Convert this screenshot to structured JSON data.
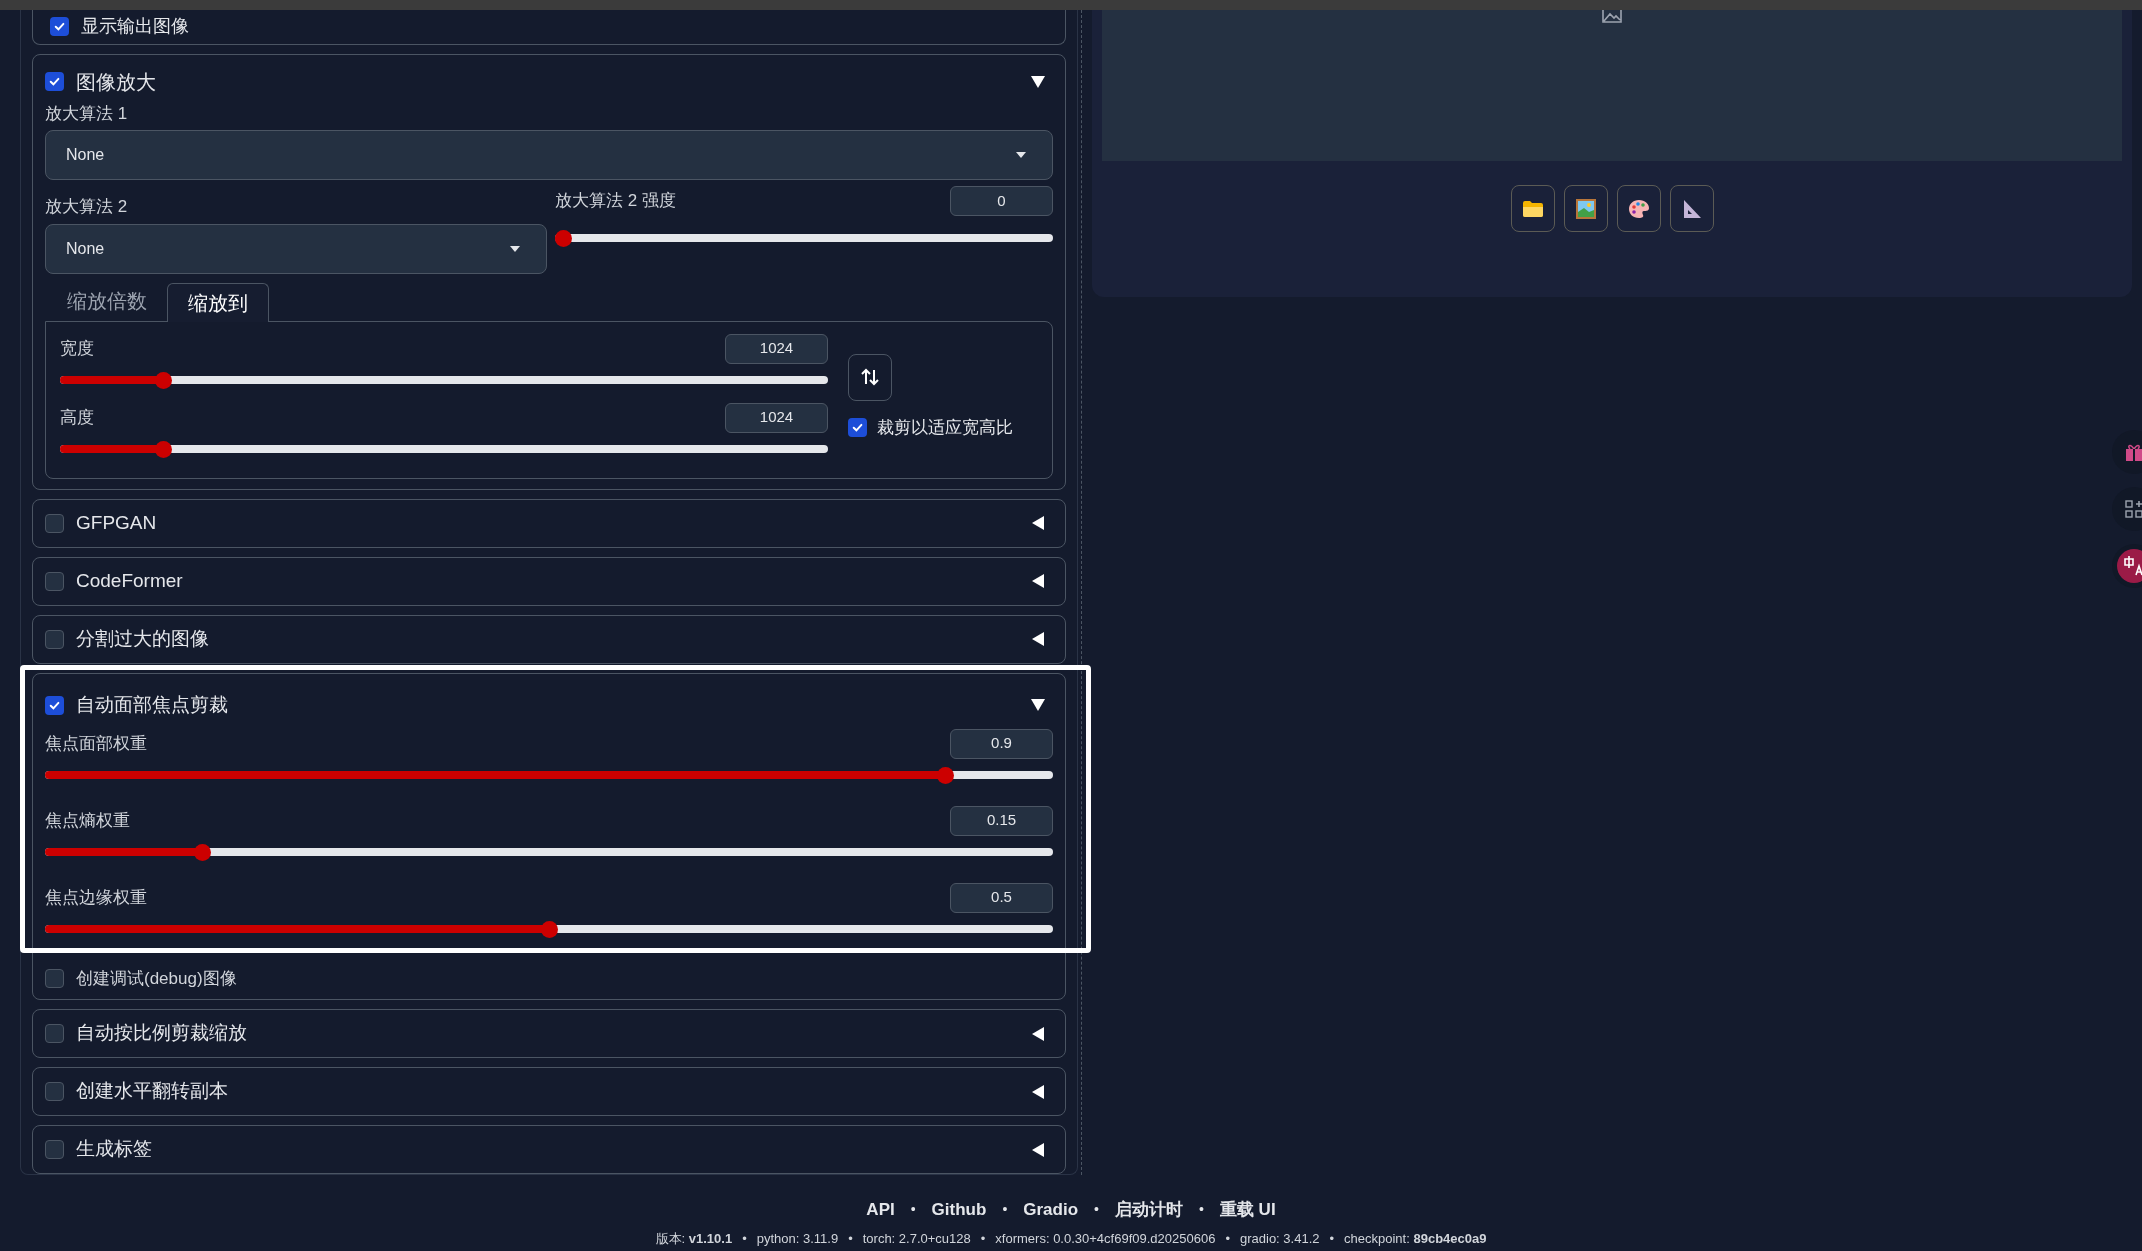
{
  "left_panel": {
    "show_output": {
      "label": "显示输出图像",
      "checked": true
    },
    "upscale": {
      "title": "图像放大",
      "checked": true,
      "expanded": true,
      "upscaler1": {
        "label": "放大算法 1",
        "value": "None"
      },
      "upscaler2": {
        "label": "放大算法 2",
        "value": "None"
      },
      "upscaler2_strength": {
        "label": "放大算法 2 强度",
        "value": "0",
        "level": 0
      },
      "tabs": [
        {
          "label": "缩放倍数",
          "selected": false
        },
        {
          "label": "缩放到",
          "selected": true
        }
      ],
      "size_sliders": [
        {
          "label": "宽度",
          "value": "1024",
          "level": 0.127
        },
        {
          "label": "高度",
          "value": "1024",
          "level": 0.127
        }
      ],
      "crop_to_fit": {
        "label": "裁剪以适应宽高比",
        "checked": true
      }
    },
    "accordions": [
      {
        "title": "GFPGAN",
        "checked": false,
        "expanded": false
      },
      {
        "title": "CodeFormer",
        "checked": false,
        "expanded": false
      },
      {
        "title": "分割过大的图像",
        "checked": false,
        "expanded": false
      },
      {
        "title": "自动面部焦点剪裁",
        "checked": true,
        "expanded": true,
        "highlighted": true,
        "sliders": [
          {
            "label": "焦点面部权重",
            "value": "0.9",
            "level": 0.9
          },
          {
            "label": "焦点熵权重",
            "value": "0.15",
            "level": 0.15
          },
          {
            "label": "焦点边缘权重",
            "value": "0.5",
            "level": 0.5
          }
        ],
        "options": [
          {
            "label": "创建调试(debug)图像",
            "checked": false
          }
        ]
      },
      {
        "title": "自动按比例剪裁缩放",
        "checked": false,
        "expanded": false
      },
      {
        "title": "创建水平翻转副本",
        "checked": false,
        "expanded": false
      },
      {
        "title": "生成标签",
        "checked": false,
        "expanded": false
      }
    ]
  },
  "footer": {
    "separator": "•",
    "links": [
      "API",
      "Github",
      "Gradio",
      "启动计时",
      "重载 UI"
    ],
    "versions": [
      "版本: **v1.10.1**",
      "python: 3.11.9",
      "torch: 2.7.0+cu128",
      "xformers: 0.0.30+4cf69f09.d20250606",
      "gradio: 3.41.2",
      "checkpoint: **89cb4ec0a9**"
    ]
  }
}
